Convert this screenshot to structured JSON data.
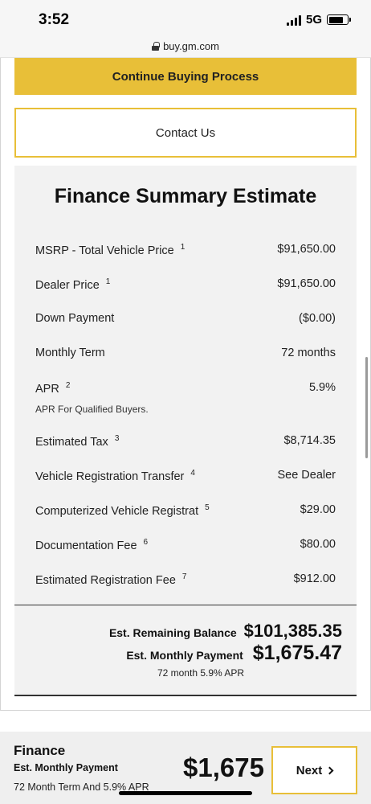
{
  "status_bar": {
    "time": "3:52",
    "network": "5G",
    "battery_level": 0.8
  },
  "browser": {
    "url": "buy.gm.com"
  },
  "actions": {
    "continue_label": "Continue Buying Process",
    "contact_label": "Contact Us"
  },
  "summary": {
    "title": "Finance Summary Estimate",
    "rows": [
      {
        "label": "MSRP - Total Vehicle Price",
        "footnote": "1",
        "value": "$91,650.00"
      },
      {
        "label": "Dealer Price",
        "footnote": "1",
        "value": "$91,650.00"
      },
      {
        "label": "Down Payment",
        "footnote": "",
        "value": "($0.00)"
      },
      {
        "label": "Monthly Term",
        "footnote": "",
        "value": "72 months"
      },
      {
        "label": "APR",
        "footnote": "2",
        "value": "5.9%",
        "note": "APR For Qualified Buyers."
      },
      {
        "label": "Estimated Tax",
        "footnote": "3",
        "value": "$8,714.35"
      },
      {
        "label": "Vehicle Registration Transfer",
        "footnote": "4",
        "value": "See Dealer"
      },
      {
        "label": "Computerized Vehicle Registrat",
        "footnote": "5",
        "value": "$29.00"
      },
      {
        "label": "Documentation Fee",
        "footnote": "6",
        "value": "$80.00"
      },
      {
        "label": "Estimated Registration Fee",
        "footnote": "7",
        "value": "$912.00"
      }
    ],
    "remaining_balance_label": "Est. Remaining Balance",
    "remaining_balance_value": "$101,385.35",
    "monthly_payment_label": "Est. Monthly Payment",
    "monthly_payment_value": "$1,675.47",
    "payment_note": "72 month 5.9% APR"
  },
  "bottom_bar": {
    "title": "Finance",
    "subtitle": "Est. Monthly Payment",
    "note": "72 Month Term And 5.9% APR",
    "amount": "$1,675",
    "next_label": "Next"
  },
  "colors": {
    "accent": "#e8bf38",
    "panel": "#f2f2f2"
  }
}
